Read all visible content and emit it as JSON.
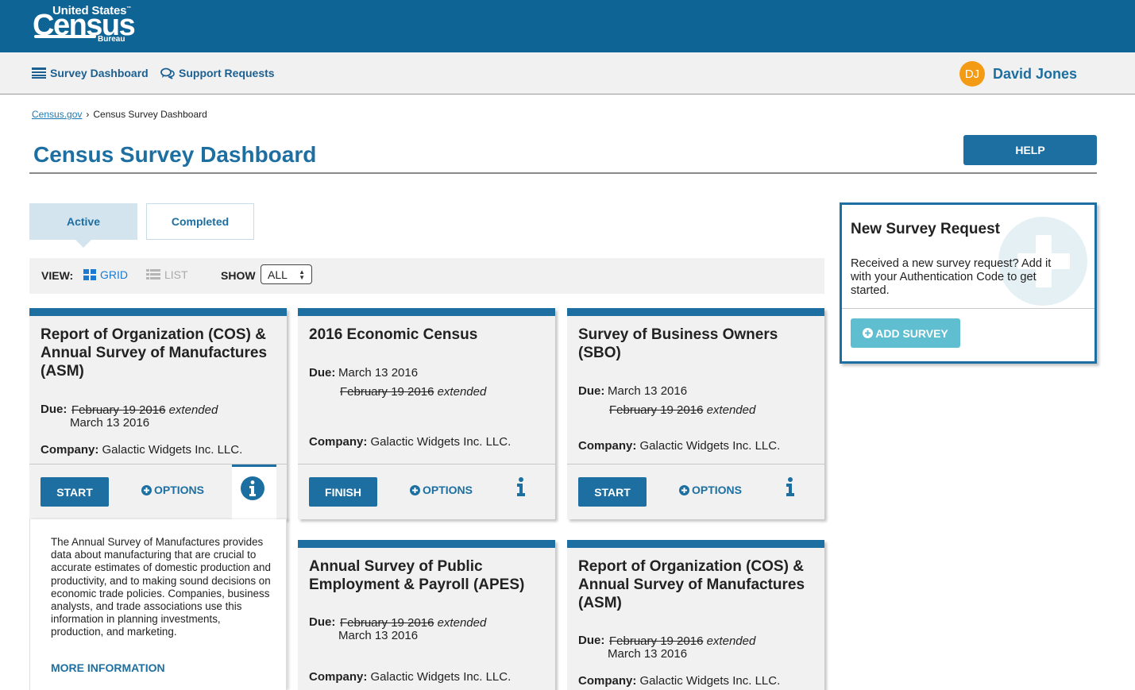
{
  "brand": {
    "line1": "United States",
    "tm": "™",
    "line2": "Census",
    "line3": "Bureau"
  },
  "nav": {
    "dashboard": "Survey Dashboard",
    "support": "Support Requests",
    "user_initials": "DJ",
    "user_name": "David Jones"
  },
  "breadcrumb": {
    "home": "Census.gov",
    "separator": "›",
    "current": "Census Survey Dashboard"
  },
  "page": {
    "title": "Census Survey Dashboard",
    "help": "HELP"
  },
  "tabs": {
    "active": "Active",
    "completed": "Completed"
  },
  "toolbar": {
    "view_label": "VIEW:",
    "grid": "GRID",
    "list": "LIST",
    "show_label": "SHOW",
    "show_value": "ALL"
  },
  "labels": {
    "due": "Due:",
    "company": "Company:",
    "options": "OPTIONS",
    "extended": "extended"
  },
  "cards": [
    {
      "title": "Report of Organization (COS) & Annual Survey of Manufactures (ASM)",
      "old_date": "February 19 2016",
      "new_date": "March 13 2016",
      "company": "Galactic Widgets Inc. LLC.",
      "action": "START"
    },
    {
      "title": "2016 Economic Census",
      "new_date": "March 13 2016",
      "old_date": "February 19 2016",
      "company": "Galactic Widgets Inc. LLC.",
      "action": "FINISH"
    },
    {
      "title": "Survey of Business Owners (SBO)",
      "new_date": "March 13 2016",
      "old_date": "February 19 2016",
      "company": "Galactic Widgets Inc. LLC.",
      "action": "START"
    },
    {
      "title": "Annual Survey of Public Employment & Payroll (APES)",
      "old_date": "February 19 2016",
      "new_date": "March 13 2016",
      "company": "Galactic Widgets Inc. LLC."
    },
    {
      "title": "Report of Organization (COS) & Annual Survey of Manufactures (ASM)",
      "old_date": "February 19 2016",
      "new_date": "March 13 2016",
      "company": "Galactic Widgets Inc. LLC."
    }
  ],
  "description": {
    "text": "The Annual Survey of Manufactures provides data about manufacturing that are crucial to accurate estimates of domestic production and productivity, and to making sound decisions on economic trade policies. Companies, business analysts, and trade associations use this information in planning investments, production, and marketing.",
    "more": "MORE INFORMATION"
  },
  "new_survey": {
    "title": "New Survey Request",
    "text": "Received a new survey request? Add it with your Authentication Code to get started.",
    "button": "ADD SURVEY"
  },
  "colors": {
    "primary": "#1c6fa0",
    "header": "#0f6496",
    "accent_avatar": "#f49b16",
    "add_button": "#5fbfd0"
  }
}
